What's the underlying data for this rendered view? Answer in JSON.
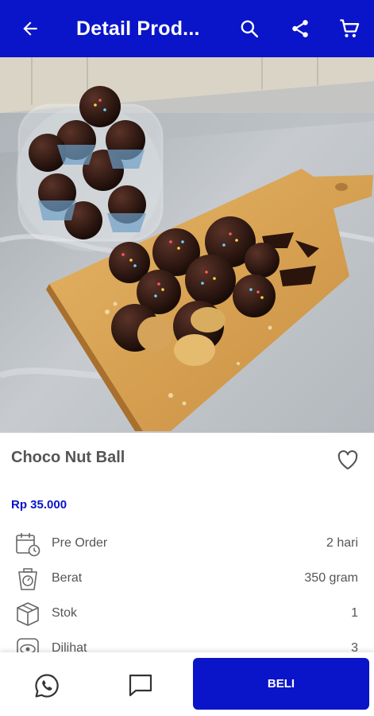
{
  "app_bar": {
    "title": "Detail Prod...",
    "background": "#0a14c8",
    "icons": [
      "back-arrow-icon",
      "search-icon",
      "share-icon",
      "cart-icon"
    ]
  },
  "carousel": {
    "image_description": "chocolate nut balls on wooden board with jar",
    "slides": 3,
    "active_slide": 1
  },
  "product": {
    "name": "Choco Nut Ball",
    "price": "Rp 35.000",
    "price_color": "#0a14c8"
  },
  "info": [
    {
      "icon": "calendar-clock-icon",
      "label": "Pre Order",
      "value": "2 hari"
    },
    {
      "icon": "scale-icon",
      "label": "Berat",
      "value": "350 gram"
    },
    {
      "icon": "box-icon",
      "label": "Stok",
      "value": "1"
    },
    {
      "icon": "eye-icon",
      "label": "Dilihat",
      "value": "3"
    }
  ],
  "bottom_bar": {
    "buy_label": "BELI",
    "icons": [
      "whatsapp-icon",
      "chat-icon"
    ]
  }
}
